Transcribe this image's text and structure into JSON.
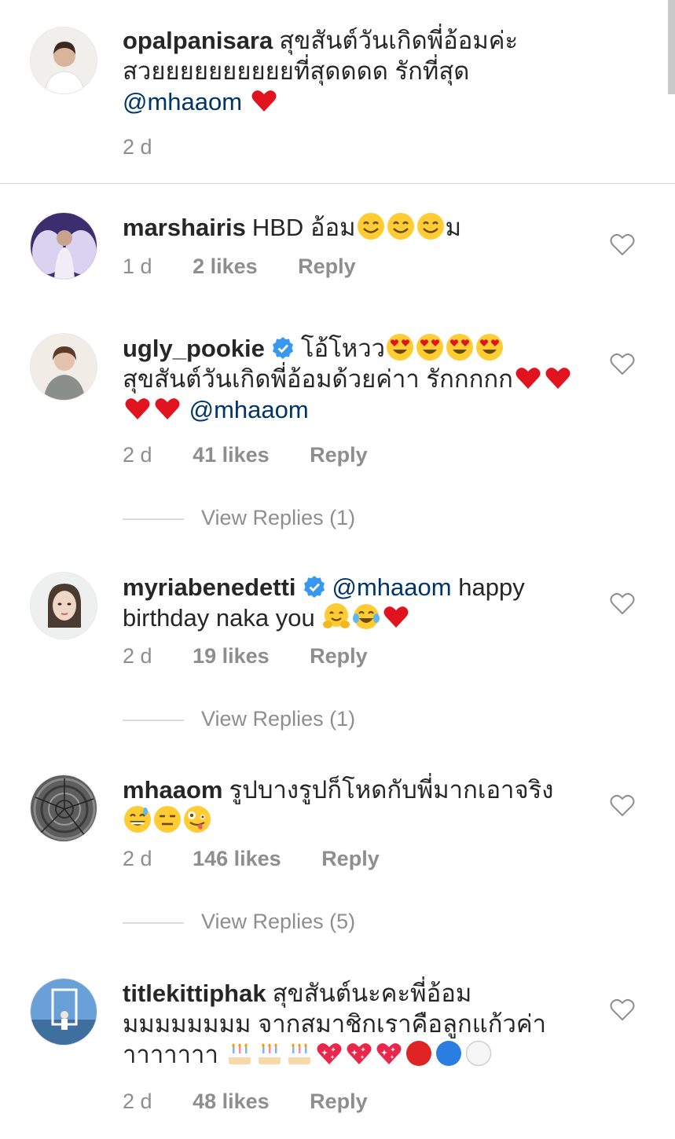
{
  "caption": {
    "username": "opalpanisara",
    "text_line1": "สุขสันต์วันเกิดพี่อ้อมค่ะ",
    "text_line2": "สวยยยยยยยยยยที่สุดดดด รักที่สุด",
    "mention": "@mhaaom",
    "emoji": [
      "red-heart"
    ],
    "time": "2 d"
  },
  "comments": [
    {
      "username": "marshairis",
      "verified": false,
      "text": "HBD อ้อม",
      "text_after": "ม",
      "emoji": [
        "smiling-face",
        "smiling-face",
        "smiling-face"
      ],
      "time": "1 d",
      "likes": "2 likes",
      "reply": "Reply"
    },
    {
      "username": "ugly_pookie",
      "verified": true,
      "text": "โอ้โหวว",
      "emoji": [
        "heart-eyes",
        "heart-eyes",
        "heart-eyes",
        "heart-eyes"
      ],
      "text_line2": "สุขสันต์วันเกิดพี่อ้อมด้วยค่าา รักกกกก",
      "emoji_line2": [
        "red-heart",
        "red-heart"
      ],
      "emoji_line3": [
        "red-heart",
        "red-heart"
      ],
      "mention": "@mhaaom",
      "time": "2 d",
      "likes": "41 likes",
      "reply": "Reply",
      "view_replies": "View Replies (1)"
    },
    {
      "username": "myriabenedetti",
      "verified": true,
      "mention": "@mhaaom",
      "text": "happy",
      "text_line2": "birthday naka you",
      "emoji": [
        "hugging-face",
        "tears-of-joy",
        "red-heart"
      ],
      "time": "2 d",
      "likes": "19 likes",
      "reply": "Reply",
      "view_replies": "View Replies (1)"
    },
    {
      "username": "mhaaom",
      "verified": false,
      "text": "รูปบางรูปก็โหดกับพี่มากเอาจริง",
      "emoji": [
        "grinning-sweat",
        "expressionless",
        "zany-face"
      ],
      "time": "2 d",
      "likes": "146 likes",
      "reply": "Reply",
      "view_replies": "View Replies (5)"
    },
    {
      "username": "titlekittiphak",
      "verified": false,
      "text": "สุขสันต์นะคะพี่อ้อม",
      "text_line2": "มมมมมมมม จากสมาชิกเราคือลูกแก้วค่า",
      "text_line3": "าาาาาาา",
      "emoji": [
        "birthday-cake",
        "birthday-cake",
        "birthday-cake",
        "sparkling-heart",
        "sparkling-heart",
        "sparkling-heart",
        "red-circle",
        "blue-circle",
        "white-circle"
      ],
      "time": "2 d",
      "likes": "48 likes",
      "reply": "Reply"
    }
  ],
  "colors": {
    "text": "#262626",
    "meta": "#8e8e8e",
    "mention": "#003569",
    "verified": "#3897f0",
    "divider": "#dbdbdb",
    "heart": "#e0131f"
  }
}
